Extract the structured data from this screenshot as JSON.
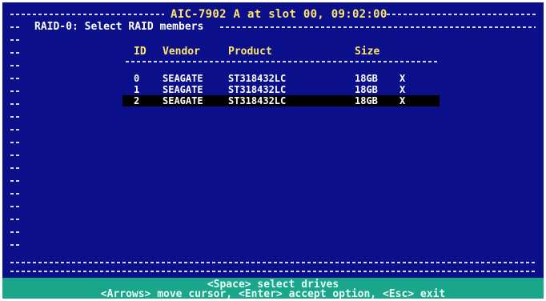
{
  "header": {
    "title": "AIC-7902 A at slot 00, 09:02:00",
    "subtitle": "RAID-0: Select RAID members"
  },
  "table": {
    "columns": [
      "ID",
      "Vendor",
      "Product",
      "Size"
    ],
    "rows": [
      {
        "id": "0",
        "vendor": "SEAGATE",
        "product": "ST318432LC",
        "size": "18GB",
        "mark": "X",
        "selected": false
      },
      {
        "id": "1",
        "vendor": "SEAGATE",
        "product": "ST318432LC",
        "size": "18GB",
        "mark": "X",
        "selected": false
      },
      {
        "id": "2",
        "vendor": "SEAGATE",
        "product": "ST318432LC",
        "size": "18GB",
        "mark": "X",
        "selected": true
      }
    ]
  },
  "footer": {
    "line1": "<Space> select drives",
    "line2": "<Arrows> move cursor, <Enter> accept option, <Esc> exit"
  },
  "colors": {
    "background": "#0b0f8a",
    "highlight": "#ffe66b",
    "footer": "#1aa68b",
    "selection": "#000000"
  }
}
